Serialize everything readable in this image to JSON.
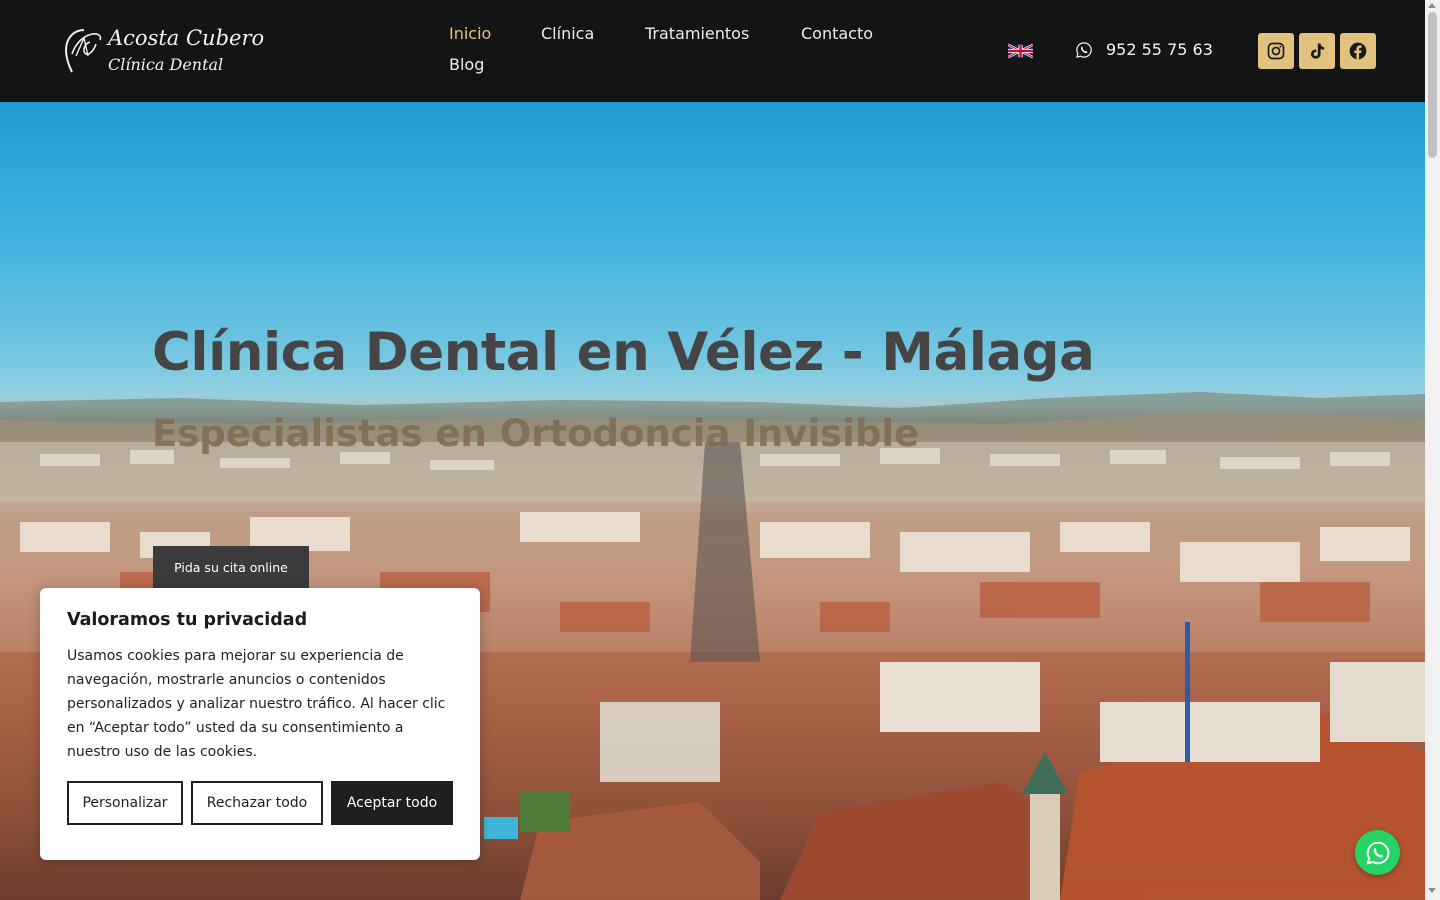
{
  "brand": {
    "name": "Acosta Cubero",
    "subtitle": "Clínica Dental",
    "logo_icon": "ac-monogram-icon"
  },
  "nav": {
    "items": [
      {
        "label": "Inicio",
        "active": true
      },
      {
        "label": "Clínica",
        "active": false
      },
      {
        "label": "Tratamientos",
        "active": false
      },
      {
        "label": "Contacto",
        "active": false
      },
      {
        "label": "Blog",
        "active": false
      }
    ]
  },
  "language": {
    "icon": "uk-flag-icon"
  },
  "contact": {
    "phone": "952 55 75 63",
    "icon": "whatsapp-icon"
  },
  "social": [
    {
      "name": "instagram",
      "icon": "instagram-icon"
    },
    {
      "name": "tiktok",
      "icon": "tiktok-icon"
    },
    {
      "name": "facebook",
      "icon": "facebook-icon"
    }
  ],
  "hero": {
    "title": "Clínica Dental en Vélez - Málaga",
    "subtitle": "Especialistas en Ortodoncia Invisible",
    "cta": "Pida su cita online"
  },
  "cookie_banner": {
    "title": "Valoramos tu privacidad",
    "text": "Usamos cookies para mejorar su experiencia de navegación, mostrarle anuncios o contenidos personalizados y analizar nuestro tráfico. Al hacer clic en “Aceptar todo” usted da su consentimiento a nuestro uso de las cookies.",
    "customize": "Personalizar",
    "reject": "Rechazar todo",
    "accept": "Aceptar todo"
  },
  "colors": {
    "header_bg": "#141414",
    "accent_gold": "#e3c17f",
    "whatsapp_green": "#25d366",
    "cta_bg": "#3b3b3b"
  }
}
